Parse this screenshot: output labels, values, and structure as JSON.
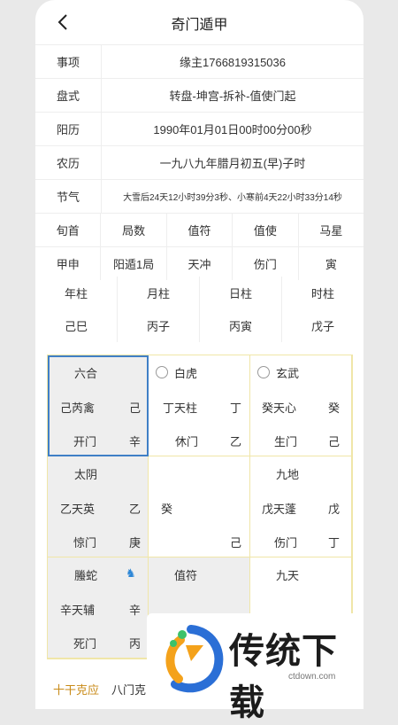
{
  "header": {
    "title": "奇门遁甲"
  },
  "info": [
    {
      "label": "事项",
      "value": "缘主1766819315036"
    },
    {
      "label": "盘式",
      "value": "转盘-坤宫-拆补-值使门起"
    },
    {
      "label": "阳历",
      "value": "1990年01月01日00时00分00秒"
    },
    {
      "label": "农历",
      "value": "一九八九年腊月初五(早)子时"
    },
    {
      "label": "节气",
      "value": "大雪后24天12小时39分3秒、小寒前4天22小时33分14秒"
    }
  ],
  "xun": {
    "headers": [
      "旬首",
      "局数",
      "值符",
      "值使",
      "马星"
    ],
    "values": [
      "甲申",
      "阳遁1局",
      "天冲",
      "伤门",
      "寅"
    ]
  },
  "pillars": {
    "headers": [
      "年柱",
      "月柱",
      "日柱",
      "时柱"
    ],
    "values": [
      "己巳",
      "丙子",
      "丙寅",
      "戊子"
    ]
  },
  "palaces": [
    {
      "god": "六合",
      "star": "己芮禽",
      "star_r": "己",
      "door": "开门",
      "door_r": "辛"
    },
    {
      "god": "白虎",
      "star": "丁天柱",
      "star_r": "丁",
      "door": "休门",
      "door_r": "乙"
    },
    {
      "god": "玄武",
      "star": "癸天心",
      "star_r": "癸",
      "door": "生门",
      "door_r": "己"
    },
    {
      "god": "太阴",
      "star": "乙天英",
      "star_r": "乙",
      "door": "惊门",
      "door_r": "庚"
    },
    {
      "center_l": "癸",
      "center_r": "己"
    },
    {
      "god": "九地",
      "star": "戊天蓬",
      "star_r": "戊",
      "door": "伤门",
      "door_r": "丁"
    },
    {
      "god": "螣蛇",
      "star": "辛天辅",
      "star_r": "辛",
      "door": "死门",
      "door_r": "丙"
    },
    {
      "god": "值符"
    },
    {
      "god": "九天"
    }
  ],
  "tabs": [
    "十干克应",
    "八门克"
  ],
  "watermark": {
    "brand": "传统下载",
    "domain": "ctdown.com"
  },
  "colors": {
    "accent": "#c88a17",
    "selected": "#3f7fc6",
    "grid": "#f0e6a8"
  }
}
